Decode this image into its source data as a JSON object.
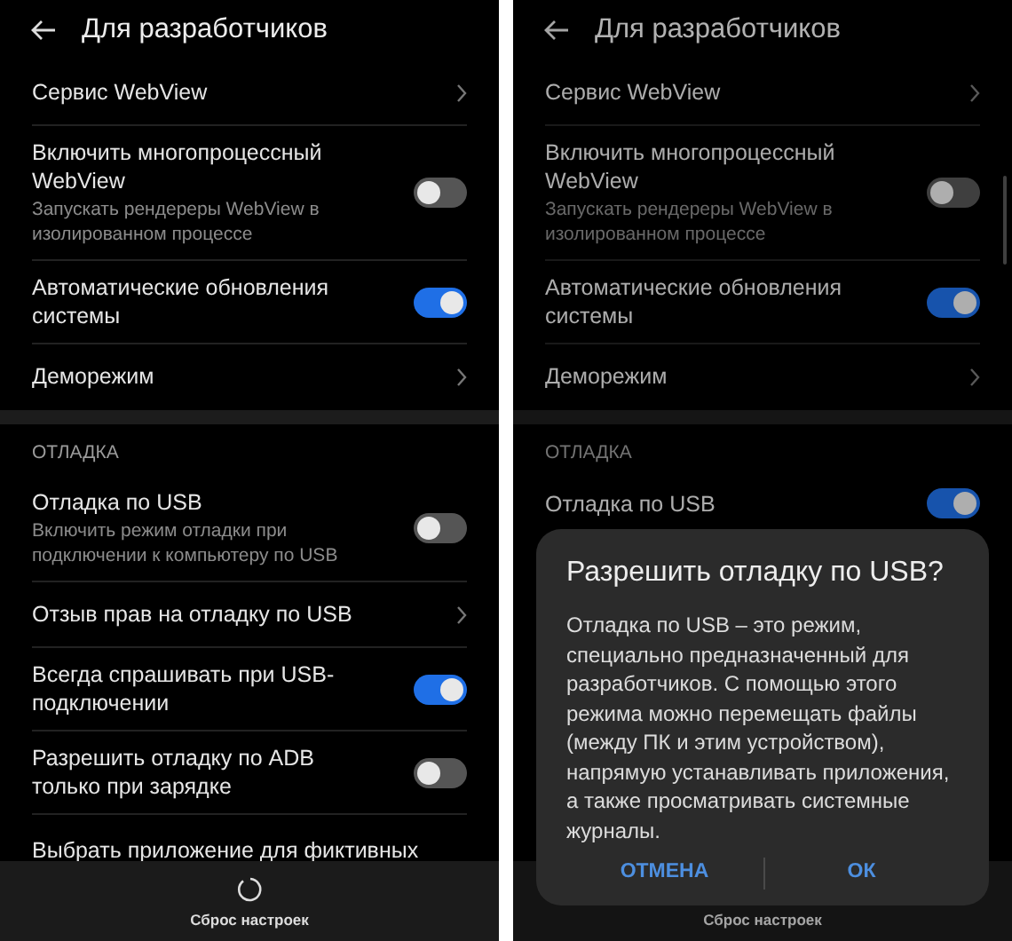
{
  "screens": [
    {
      "title": "Для разработчиков",
      "items": [
        {
          "kind": "nav",
          "title": "Сервис WebView"
        },
        {
          "kind": "toggle",
          "title": "Включить многопроцессный WebView",
          "subtitle": "Запускать рендереры WebView в изолированном процессе",
          "on": false
        },
        {
          "kind": "toggle",
          "title": "Автоматические обновления системы",
          "on": true
        },
        {
          "kind": "nav",
          "title": "Деморежим"
        },
        {
          "kind": "section",
          "title": "ОТЛАДКА"
        },
        {
          "kind": "toggle",
          "title": "Отладка по USB",
          "subtitle": "Включить режим отладки при подключении к компьютеру по USB",
          "on": false
        },
        {
          "kind": "nav",
          "title": "Отзыв прав на отладку по USB"
        },
        {
          "kind": "toggle",
          "title": "Всегда спрашивать при USB-подключении",
          "on": true
        },
        {
          "kind": "toggle",
          "title": "Разрешить отладку по ADB только при зарядке",
          "on": false
        },
        {
          "kind": "plain",
          "title": "Выбрать приложение для фиктивных"
        }
      ],
      "reset": {
        "label": "Сброс настроек"
      }
    },
    {
      "title": "Для разработчиков",
      "scrollbar": true,
      "items": [
        {
          "kind": "nav",
          "title": "Сервис WebView"
        },
        {
          "kind": "toggle",
          "title": "Включить многопроцессный WebView",
          "subtitle": "Запускать рендереры WebView в изолированном процессе",
          "on": false
        },
        {
          "kind": "toggle",
          "title": "Автоматические обновления системы",
          "on": true
        },
        {
          "kind": "nav",
          "title": "Деморежим"
        },
        {
          "kind": "section",
          "title": "ОТЛАДКА"
        },
        {
          "kind": "toggle",
          "title": "Отладка по USB",
          "on": true
        }
      ],
      "reset": {
        "label": "Сброс настроек"
      },
      "dialog": {
        "title": "Разрешить отладку по USB?",
        "message": "Отладка по USB – это режим, специально предназначенный для разработчиков. С помощью этого режима можно перемещать файлы (между ПК и этим устройством), напрямую устанавливать приложения, а также просматривать системные журналы.",
        "buttons": [
          "ОТМЕНА",
          "ОК"
        ]
      }
    }
  ]
}
